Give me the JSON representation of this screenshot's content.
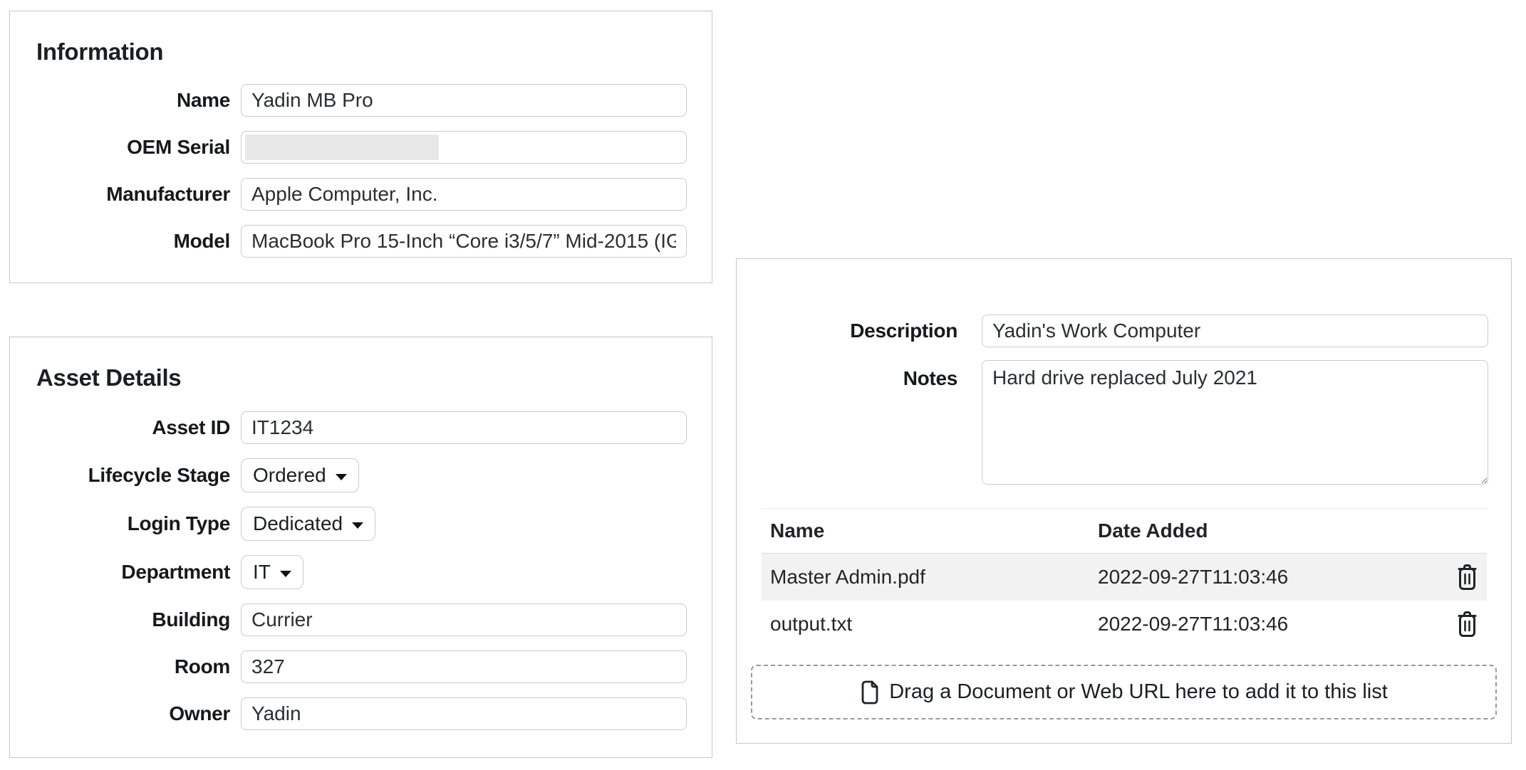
{
  "info_panel": {
    "title": "Information",
    "fields": [
      {
        "label": "Name",
        "value": "Yadin MB Pro"
      },
      {
        "label": "OEM Serial",
        "value": "",
        "note": "value-redacted-gray-block"
      },
      {
        "label": "Manufacturer",
        "value": "Apple Computer, Inc."
      },
      {
        "label": "Model",
        "value": "MacBook Pro 15-Inch “Core i3/5/7” Mid-2015 (IG"
      }
    ]
  },
  "asset_panel": {
    "title": "Asset Details",
    "fields": [
      {
        "label": "Asset ID",
        "value": "IT1234",
        "type": "text"
      },
      {
        "label": "Lifecycle Stage",
        "value": "Ordered",
        "type": "select"
      },
      {
        "label": "Login Type",
        "value": "Dedicated",
        "type": "select"
      },
      {
        "label": "Department",
        "value": "IT",
        "type": "select"
      },
      {
        "label": "Building",
        "value": "Currier",
        "type": "text"
      },
      {
        "label": "Room",
        "value": "327",
        "type": "text"
      },
      {
        "label": "Owner",
        "value": "Yadin",
        "type": "text"
      }
    ]
  },
  "docs_panel": {
    "description_label": "Description",
    "description_value": "Yadin's Work Computer",
    "notes_label": "Notes",
    "notes_value": "Hard drive replaced July 2021",
    "table": {
      "columns": [
        "Name",
        "Date Added"
      ],
      "rows": [
        {
          "name": "Master Admin.pdf",
          "date_added": "2022-09-27T11:03:46",
          "delete_icon": "trash-icon"
        },
        {
          "name": "output.txt",
          "date_added": "2022-09-27T11:03:46",
          "delete_icon": "trash-icon"
        }
      ]
    },
    "dropzone_text": "Drag a Document or Web URL here to add it to this list",
    "dropzone_icon": "document-icon"
  },
  "colors": {
    "panel_border": "#c6c6c6",
    "input_border": "#cbcbcb",
    "text": "#212529",
    "row_stripe": "#f2f2f2",
    "redacted_block": "#e8e8e8"
  }
}
